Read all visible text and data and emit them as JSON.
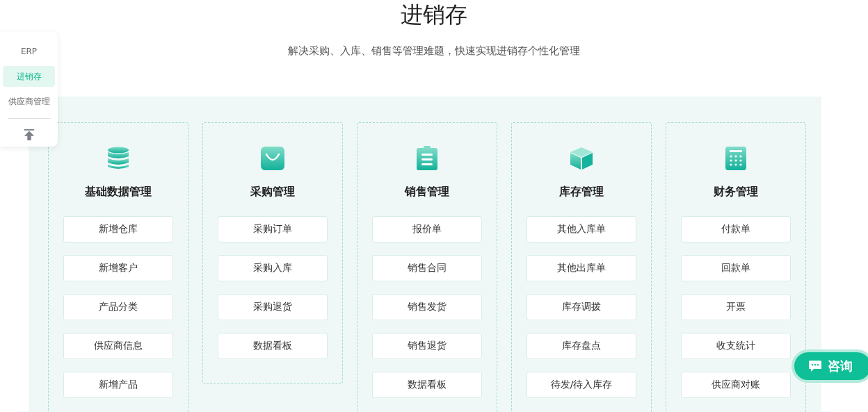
{
  "header": {
    "title": "进销存",
    "subtitle": "解决采购、入库、销售等管理难题，快速实现进销存个性化管理"
  },
  "side_nav": {
    "items": [
      {
        "label": "ERP",
        "selected": false
      },
      {
        "label": "进销存",
        "selected": true
      },
      {
        "label": "供应商管理",
        "selected": false
      }
    ]
  },
  "modules": [
    {
      "title": "基础数据管理",
      "items": [
        "新增仓库",
        "新增客户",
        "产品分类",
        "供应商信息",
        "新增产品"
      ]
    },
    {
      "title": "采购管理",
      "items": [
        "采购订单",
        "采购入库",
        "采购退货",
        "数据看板"
      ]
    },
    {
      "title": "销售管理",
      "items": [
        "报价单",
        "销售合同",
        "销售发货",
        "销售退货",
        "数据看板"
      ]
    },
    {
      "title": "库存管理",
      "items": [
        "其他入库单",
        "其他出库单",
        "库存调拨",
        "库存盘点",
        "待发/待入库存"
      ]
    },
    {
      "title": "财务管理",
      "items": [
        "付款单",
        "回款单",
        "开票",
        "收支统计",
        "供应商对账"
      ]
    }
  ],
  "consult_button": {
    "label": "咨询"
  }
}
